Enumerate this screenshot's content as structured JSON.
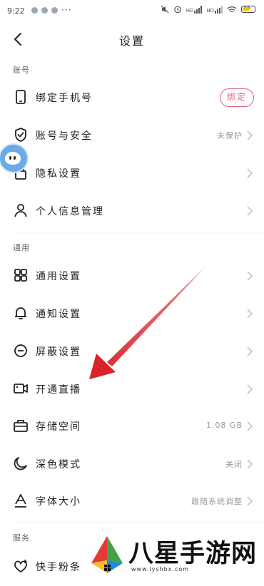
{
  "status_bar": {
    "time": "9:22",
    "more": "···",
    "battery_level": "65"
  },
  "header": {
    "title": "设置"
  },
  "sections": {
    "account": {
      "title": "账号",
      "items": [
        {
          "label": "绑定手机号",
          "button": "绑定",
          "icon": "phone-icon"
        },
        {
          "label": "账号与安全",
          "value": "未保护",
          "icon": "shield-check-icon"
        },
        {
          "label": "隐私设置",
          "icon": "lock-icon"
        },
        {
          "label": "个人信息管理",
          "icon": "person-icon"
        }
      ]
    },
    "general": {
      "title": "通用",
      "items": [
        {
          "label": "通用设置",
          "icon": "grid-icon"
        },
        {
          "label": "通知设置",
          "icon": "bell-icon"
        },
        {
          "label": "屏蔽设置",
          "icon": "block-icon"
        },
        {
          "label": "开通直播",
          "icon": "video-camera-icon"
        },
        {
          "label": "存储空间",
          "value": "1.08 GB",
          "icon": "storage-icon"
        },
        {
          "label": "深色模式",
          "value": "关闭",
          "icon": "moon-icon"
        },
        {
          "label": "字体大小",
          "value": "跟随系统调整",
          "icon": "font-size-icon"
        }
      ]
    },
    "service": {
      "title": "服务",
      "items": [
        {
          "label": "快手粉条",
          "icon": "fan-boost-icon"
        }
      ]
    }
  },
  "watermark": {
    "brand": "八星手游网",
    "url": "www.lyshbx.com"
  },
  "colors": {
    "accent": "#e0607f",
    "annotation_arrow": "#d8232a",
    "float_ball": "#6aaae8"
  }
}
